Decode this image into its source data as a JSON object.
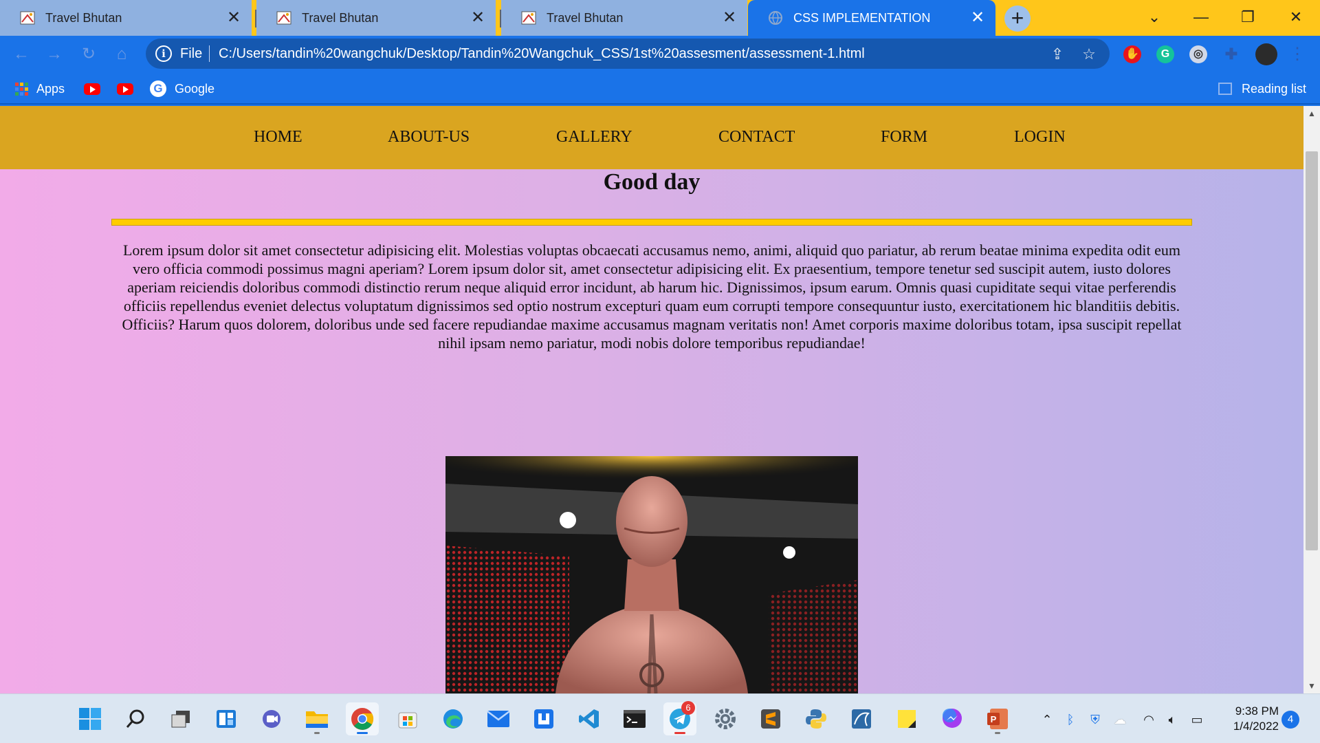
{
  "browser": {
    "tabs": [
      {
        "title": "Travel Bhutan",
        "icon": "travel-favicon",
        "active": false
      },
      {
        "title": "Travel Bhutan",
        "icon": "travel-favicon",
        "active": false
      },
      {
        "title": "Travel Bhutan",
        "icon": "travel-favicon",
        "active": false
      },
      {
        "title": "CSS IMPLEMENTATION",
        "icon": "globe-favicon",
        "active": true
      }
    ],
    "close_glyph": "✕",
    "new_tab_glyph": "+",
    "address": {
      "scheme": "File",
      "url": "C:/Users/tandin%20wangchuk/Desktop/Tandin%20Wangchuk_CSS/1st%20assesment/assessment-1.html"
    },
    "bookmarks": {
      "apps_label": "Apps",
      "google_label": "Google",
      "reading_list_label": "Reading list"
    }
  },
  "page": {
    "nav": [
      "HOME",
      "ABOUT-US",
      "GALLERY",
      "CONTACT",
      "FORM",
      "LOGIN"
    ],
    "heading": "Good day",
    "body_text": "Lorem ipsum dolor sit amet consectetur adipisicing elit. Molestias voluptas obcaecati accusamus nemo, animi, aliquid quo pariatur, ab rerum beatae minima expedita odit eum vero officia commodi possimus magni aperiam? Lorem ipsum dolor sit, amet consectetur adipisicing elit. Ex praesentium, tempore tenetur sed suscipit autem, iusto dolores aperiam reiciendis doloribus commodi distinctio rerum neque aliquid error incidunt, ab harum hic. Dignissimos, ipsum earum. Omnis quasi cupiditate sequi vitae perferendis officiis repellendus eveniet delectus voluptatum dignissimos sed optio nostrum excepturi quam eum corrupti tempore consequuntur iusto, exercitationem hic blanditiis debitis. Officiis? Harum quos dolorem, doloribus unde sed facere repudiandae maxime accusamus magnam veritatis non! Amet corporis maxime doloribus totam, ipsa suscipit repellat nihil ipsam nemo pariatur, modi nobis dolore temporibus repudiandae!"
  },
  "taskbar": {
    "apps": [
      "start",
      "search",
      "task-view",
      "widgets",
      "teams-chat",
      "file-explorer",
      "chrome",
      "microsoft-store",
      "edge",
      "mail",
      "app-store",
      "vscode",
      "terminal",
      "telegram",
      "settings",
      "sublime-text",
      "python",
      "mysql-workbench",
      "sticky-notes",
      "messenger",
      "powerpoint"
    ],
    "telegram_badge": "6",
    "time": "9:38 PM",
    "date": "1/4/2022",
    "notifications": "4"
  },
  "colors": {
    "tab_strip": "#ffc61a",
    "toolbar": "#1a73e8",
    "site_nav": "#daa520",
    "divider": "#ffcc00",
    "page_gradient_start": "#f2abe8",
    "page_gradient_end": "#b6b3e9"
  }
}
